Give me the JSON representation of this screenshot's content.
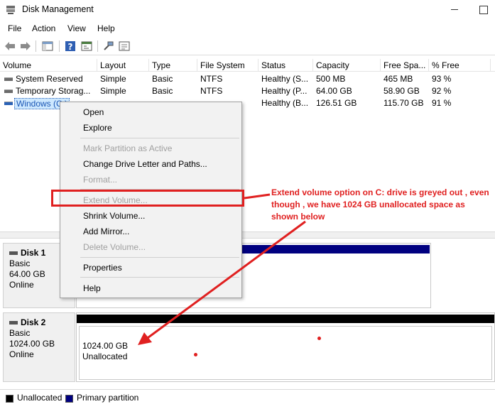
{
  "window": {
    "title": "Disk Management"
  },
  "menu": [
    "File",
    "Action",
    "View",
    "Help"
  ],
  "toolbar": {
    "icons": [
      "back-arrow-icon",
      "forward-arrow-icon",
      "console-tree-icon",
      "help-icon",
      "properties-icon",
      "connect-icon",
      "settings-icon"
    ]
  },
  "volume_list": {
    "columns": [
      "Volume",
      "Layout",
      "Type",
      "File System",
      "Status",
      "Capacity",
      "Free Spa...",
      "% Free"
    ],
    "rows": [
      {
        "volume": "System Reserved",
        "layout": "Simple",
        "type": "Basic",
        "fs": "NTFS",
        "status": "Healthy (S...",
        "capacity": "500 MB",
        "free": "465 MB",
        "pct": "93 %"
      },
      {
        "volume": "Temporary Storag...",
        "layout": "Simple",
        "type": "Basic",
        "fs": "NTFS",
        "status": "Healthy (P...",
        "capacity": "64.00 GB",
        "free": "58.90 GB",
        "pct": "92 %"
      },
      {
        "volume": "Windows (C:)",
        "layout": "",
        "type": "",
        "fs": "",
        "status": "Healthy (B...",
        "capacity": "126.51 GB",
        "free": "115.70 GB",
        "pct": "91 %"
      }
    ]
  },
  "context_menu": {
    "items": [
      {
        "label": "Open",
        "disabled": false
      },
      {
        "label": "Explore",
        "disabled": false
      },
      {
        "label": "Mark Partition as Active",
        "disabled": true
      },
      {
        "label": "Change Drive Letter and Paths...",
        "disabled": false
      },
      {
        "label": "Format...",
        "disabled": true
      },
      {
        "label": "Extend Volume...",
        "disabled": true
      },
      {
        "label": "Shrink Volume...",
        "disabled": false
      },
      {
        "label": "Add Mirror...",
        "disabled": false
      },
      {
        "label": "Delete Volume...",
        "disabled": true
      },
      {
        "label": "Properties",
        "disabled": false
      },
      {
        "label": "Help",
        "disabled": false
      }
    ]
  },
  "disks": [
    {
      "name": "Disk 1",
      "type": "Basic",
      "size": "64.00 GB",
      "state": "Online"
    },
    {
      "name": "Disk 2",
      "type": "Basic",
      "size": "1024.00 GB",
      "state": "Online",
      "partition_size": "1024.00 GB",
      "partition_label": "Unallocated"
    }
  ],
  "legend": [
    {
      "label": "Unallocated",
      "color": "#000000"
    },
    {
      "label": "Primary partition",
      "color": "#000080"
    }
  ],
  "annotation": {
    "text": "Extend volume option on C: drive is greyed out , even though , we have 1024 GB unallocated space as shown below",
    "color": "#e02020"
  }
}
